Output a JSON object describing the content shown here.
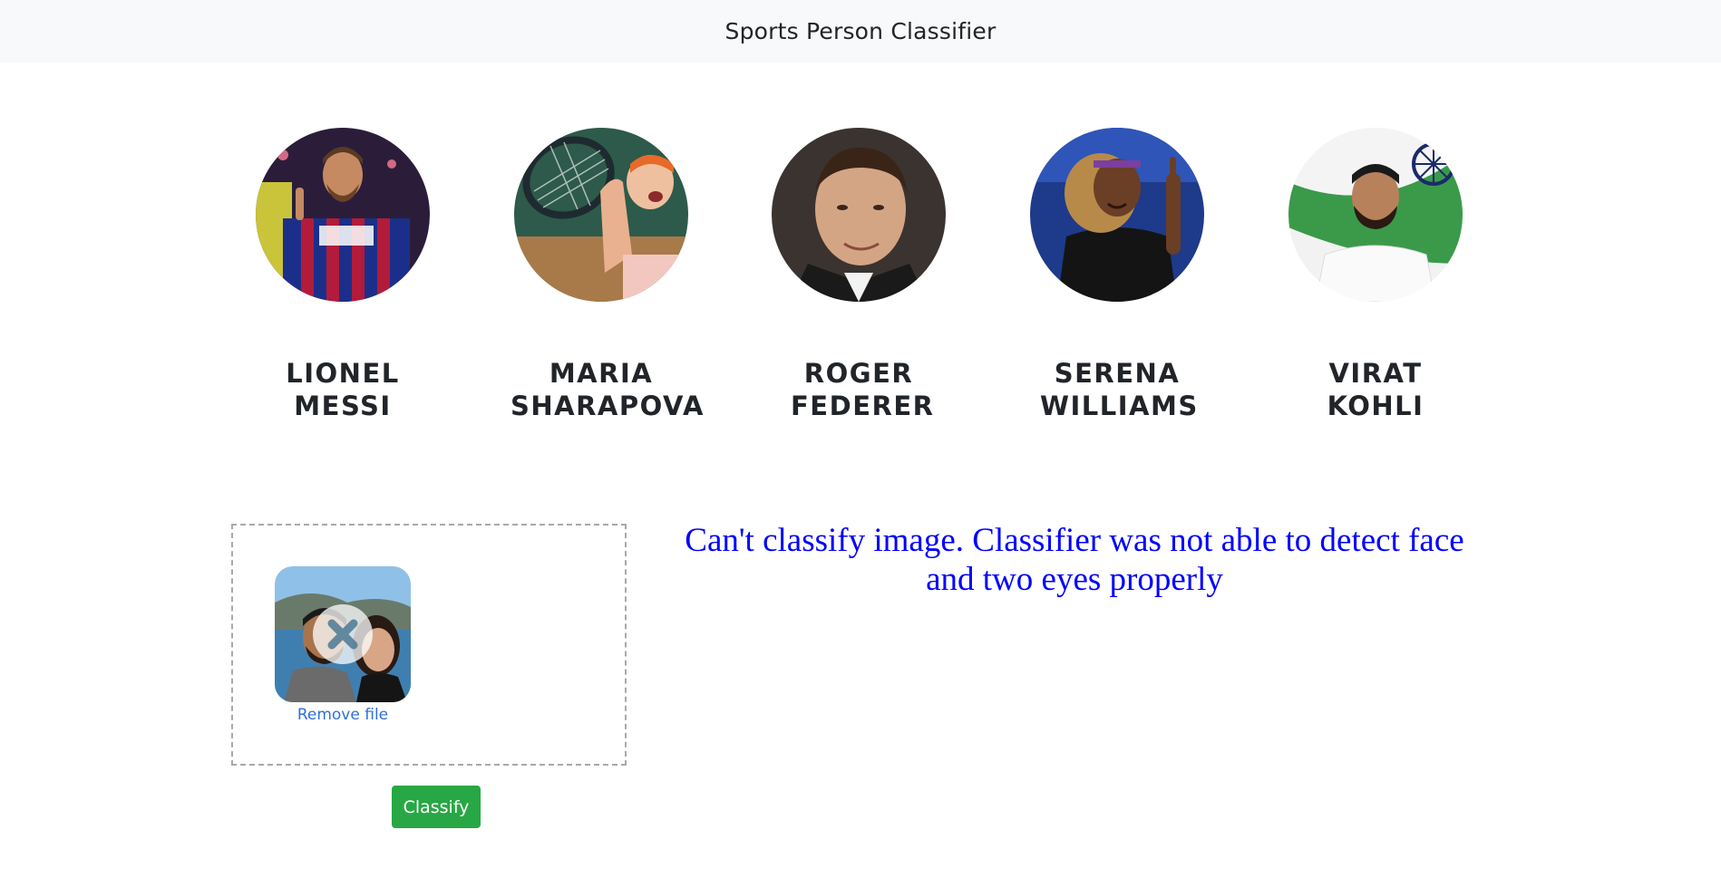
{
  "navbar": {
    "brand": "Sports Person Classifier"
  },
  "people": [
    {
      "name": "LIONEL\nMESSI",
      "slug": "lionel-messi"
    },
    {
      "name": "MARIA\nSHARAPOVA",
      "slug": "maria-sharapova"
    },
    {
      "name": "ROGER\nFEDERER",
      "slug": "roger-federer"
    },
    {
      "name": "SERENA\nWILLIAMS",
      "slug": "serena-williams"
    },
    {
      "name": "VIRAT KOHLI",
      "slug": "virat-kohli"
    }
  ],
  "people_labels": {
    "p0": "LIONEL MESSI",
    "p1": "MARIA SHARAPOVA",
    "p2": "ROGER FEDERER",
    "p3": "SERENA WILLIAMS",
    "p4": "VIRAT KOHLI"
  },
  "dropzone": {
    "remove_label": "Remove file"
  },
  "actions": {
    "classify_label": "Classify"
  },
  "result": {
    "error_message": "Can't classify image. Classifier was not able to detect face and two eyes properly"
  },
  "colors": {
    "navbar_bg": "#f8f9fa",
    "button_green": "#28a745",
    "error_text": "#0000ff",
    "link_blue": "#2f6fdb"
  }
}
